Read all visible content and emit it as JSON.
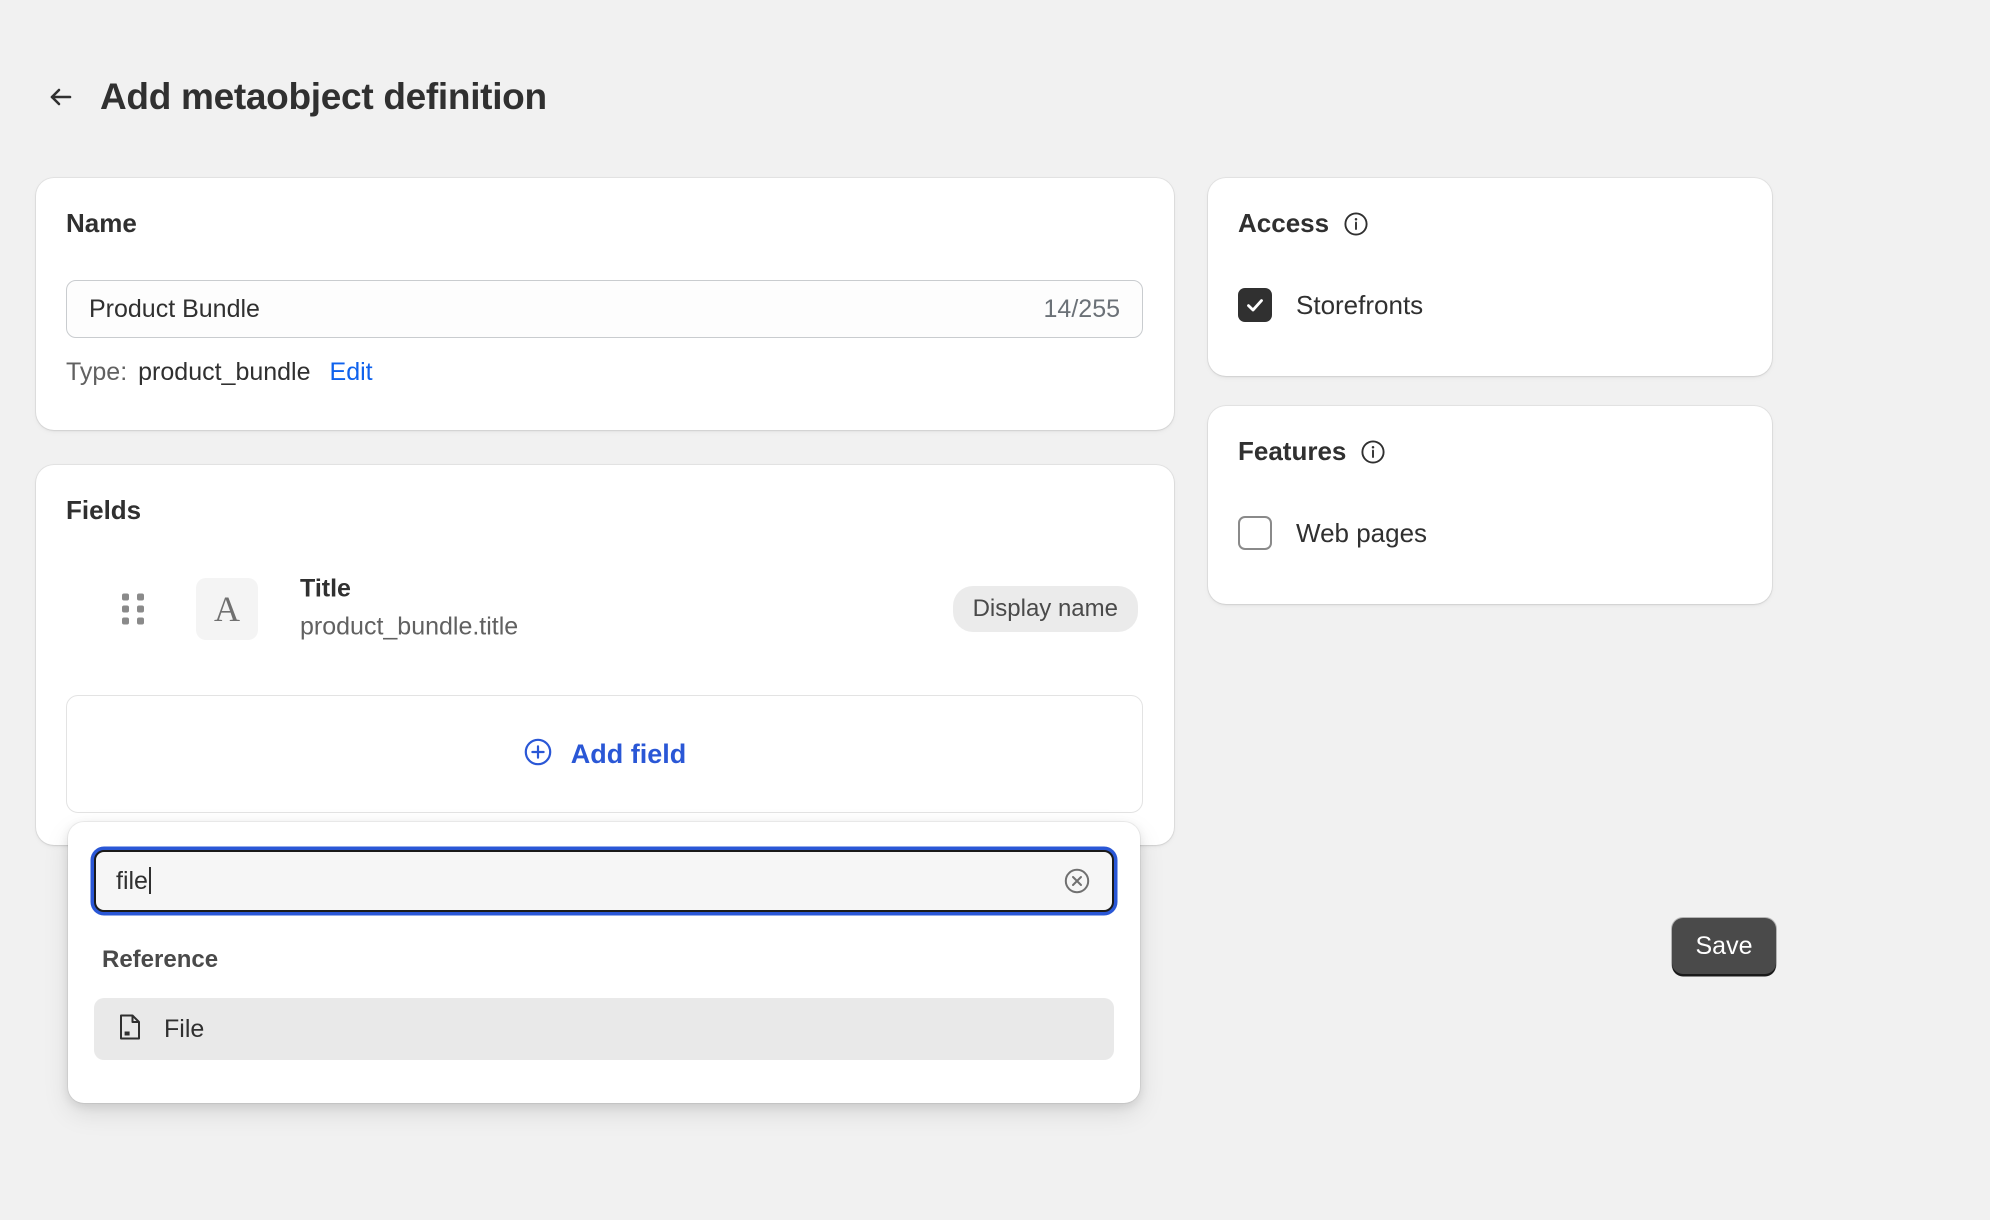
{
  "header": {
    "back_icon": "arrow-left-icon",
    "title": "Add metaobject definition"
  },
  "name_card": {
    "heading": "Name",
    "input_value": "Product Bundle",
    "input_placeholder": "Name",
    "counter": "14/255",
    "type_label": "Type:",
    "type_value": "product_bundle",
    "edit_link": "Edit"
  },
  "fields_card": {
    "heading": "Fields",
    "rows": [
      {
        "drag_icon": "drag-handle-icon",
        "type_icon_glyph": "A",
        "name": "Title",
        "key": "product_bundle.title",
        "badge": "Display name"
      }
    ],
    "add_field": {
      "icon": "circle-plus-icon",
      "label": "Add field"
    }
  },
  "type_popover": {
    "search_value": "file",
    "search_placeholder": "Search field types",
    "clear_icon": "circle-x-icon",
    "group_label": "Reference",
    "options": [
      {
        "icon": "file-icon",
        "label": "File"
      }
    ]
  },
  "access_card": {
    "heading": "Access",
    "info_icon": "info-circle-icon",
    "checkbox": {
      "label": "Storefronts",
      "checked": true
    }
  },
  "features_card": {
    "heading": "Features",
    "info_icon": "info-circle-icon",
    "checkbox": {
      "label": "Web pages",
      "checked": false
    }
  },
  "footer": {
    "save_label": "Save"
  },
  "colors": {
    "page_background": "#f1f1f1",
    "card_background": "#ffffff",
    "text_primary": "#303030",
    "text_secondary": "#616161",
    "link_blue": "#0f62ed",
    "action_blue": "#2a57d6",
    "dark": "#303030",
    "save_button": "#4a4a4a"
  }
}
